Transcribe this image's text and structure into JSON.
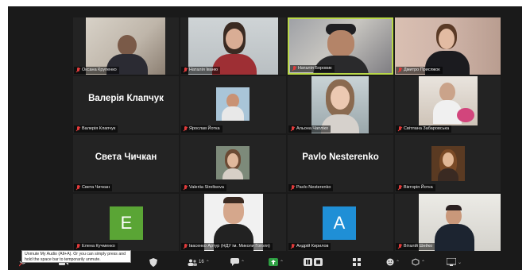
{
  "meeting": {
    "participants": [
      {
        "name": "Оксана Крупенко",
        "muted": true
      },
      {
        "name": "Наталія Іваню",
        "muted": true
      },
      {
        "name": "Наталія Боровик",
        "muted": true,
        "active_speaker": true
      },
      {
        "name": "Дмитро Присяжок",
        "muted": true
      },
      {
        "name": "Валерія Клапчук",
        "display_name": "Валерія Клапчук",
        "muted": true
      },
      {
        "name": "Ярослав Йотка",
        "muted": true
      },
      {
        "name": "Альона Чапліко",
        "muted": true
      },
      {
        "name": "Світлана Забаровська",
        "muted": true
      },
      {
        "name": "Света Чичкан",
        "display_name": "Света Чичкан",
        "muted": true
      },
      {
        "name": "Valeriia Streltsova",
        "muted": true
      },
      {
        "name": "Pavlo Nesterenko",
        "display_name": "Pavlo Nesterenko",
        "muted": true
      },
      {
        "name": "Вікторія Йотка",
        "muted": true
      },
      {
        "name": "Елена Кучменко",
        "avatar_letter": "E",
        "avatar_color": "#5aa535",
        "muted": true
      },
      {
        "name": "Івасенко Артур (НДУ ім. Миколи Гоголя)",
        "muted": true
      },
      {
        "name": "Андрій Кирилов",
        "avatar_letter": "A",
        "avatar_color": "#1f8fd6",
        "muted": true
      },
      {
        "name": "Віталій Шейко",
        "muted": true
      }
    ]
  },
  "tooltip": {
    "text": "Unmute My Audio (Alt+A). Or you can simply press and hold the space bar to temporarily unmute."
  },
  "toolbar": {
    "participants_count": "16",
    "colors": {
      "accent_green": "#b9d848",
      "share_green": "#2ea043",
      "muted_red": "#e23b3b"
    }
  }
}
